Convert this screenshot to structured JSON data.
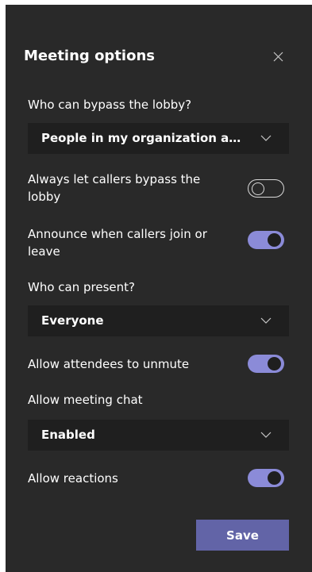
{
  "header": {
    "title": "Meeting options",
    "close_icon": "close-icon"
  },
  "lobby": {
    "label": "Who can bypass the lobby?",
    "selected": "People in my organization and ..."
  },
  "callers_bypass": {
    "label": "Always let callers bypass the lobby",
    "enabled": false
  },
  "announce_callers": {
    "label": "Announce when callers join or leave",
    "enabled": true
  },
  "presenters": {
    "label": "Who can present?",
    "selected": "Everyone"
  },
  "unmute": {
    "label": "Allow attendees to unmute",
    "enabled": true
  },
  "chat": {
    "label": "Allow meeting chat",
    "selected": "Enabled"
  },
  "reactions": {
    "label": "Allow reactions",
    "enabled": true
  },
  "actions": {
    "save_label": "Save"
  },
  "colors": {
    "panel_bg": "#292929",
    "dropdown_bg": "#1f1f1f",
    "toggle_on": "#8b8bd8",
    "primary_button": "#6264a7",
    "text": "#ffffff"
  }
}
